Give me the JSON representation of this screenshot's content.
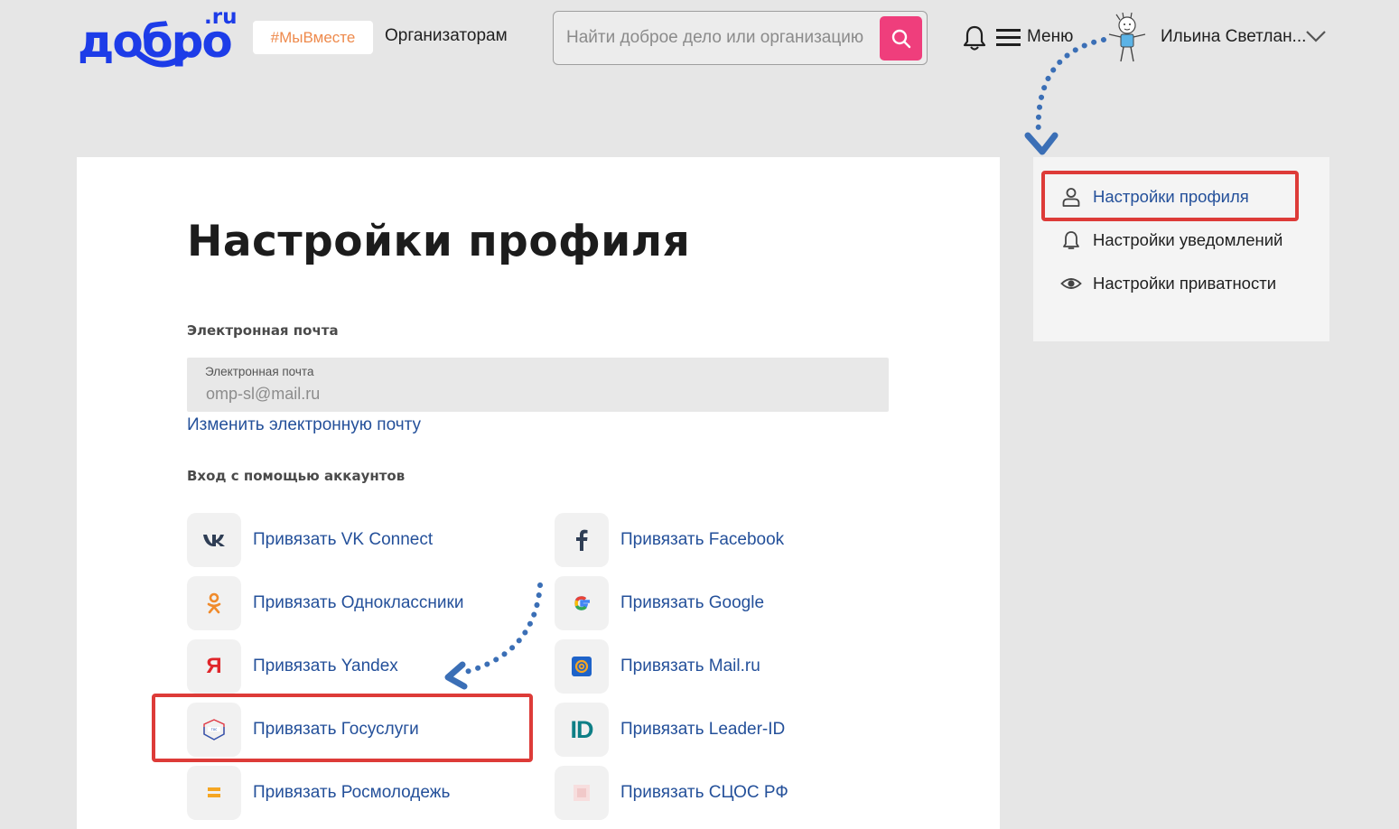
{
  "header": {
    "logo_main": "добро",
    "logo_ru": ".ru",
    "tag": "#МыВместе",
    "organizers_link": "Организаторам",
    "search_placeholder": "Найти доброе дело или организацию",
    "menu_label": "Меню",
    "user_name": "Ильина Светлан..."
  },
  "main": {
    "title": "Настройки профиля",
    "email_section": "Электронная почта",
    "email_field_caption": "Электронная почта",
    "email_value": "omp-sl@mail.ru",
    "change_email": "Изменить электронную почту",
    "accounts_section": "Вход с помощью аккаунтов",
    "accounts": [
      {
        "label": "Привязать VK Connect",
        "icon": "vk-icon"
      },
      {
        "label": "Привязать Facebook",
        "icon": "facebook-icon"
      },
      {
        "label": "Привязать Одноклассники",
        "icon": "odnoklassniki-icon"
      },
      {
        "label": "Привязать Google",
        "icon": "google-icon"
      },
      {
        "label": "Привязать Yandex",
        "icon": "yandex-icon"
      },
      {
        "label": "Привязать Mail.ru",
        "icon": "mailru-icon"
      },
      {
        "label": "Привязать Госуслуги",
        "icon": "gosuslugi-icon"
      },
      {
        "label": "Привязать Leader-ID",
        "icon": "leader-id-icon"
      },
      {
        "label": "Привязать Росмолодежь",
        "icon": "rosmolodezh-icon"
      },
      {
        "label": "Привязать СЦОС РФ",
        "icon": "scos-icon"
      }
    ]
  },
  "sidebar": {
    "items": [
      {
        "label": "Настройки профиля",
        "icon": "user-icon",
        "active": true
      },
      {
        "label": "Настройки уведомлений",
        "icon": "bell-icon"
      },
      {
        "label": "Настройки приватности",
        "icon": "eye-icon"
      }
    ]
  },
  "colors": {
    "brand": "#1d3ce8",
    "search_button": "#ef3e7c",
    "link": "#24509a",
    "highlight": "#dd3b38",
    "annotation_arrow": "#3b6fb6"
  }
}
